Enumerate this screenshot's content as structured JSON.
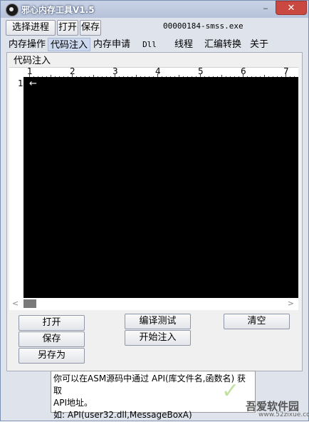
{
  "window": {
    "title": "邪心内存工具V1.5",
    "minimize": "‒",
    "close": "✕"
  },
  "toolbar": {
    "select_process": "选择进程",
    "open": "打开",
    "save": "保存",
    "process_label": "00000184-smss.exe"
  },
  "tabs": [
    "内存操作",
    "代码注入",
    "内存申请",
    "Dll",
    "线程",
    "汇编转换",
    "关于"
  ],
  "active_tab": "代码注入",
  "group": {
    "label": "代码注入"
  },
  "ruler": {
    "numbers": [
      "1",
      "2",
      "3",
      "4",
      "5",
      "6",
      "7"
    ]
  },
  "editor": {
    "line_number": "1",
    "cursor_glyph": "←",
    "background": "#000000"
  },
  "scrollbar": {
    "left": "<",
    "right": ">"
  },
  "buttons": {
    "open": "打开",
    "save": "保存",
    "save_as": "另存为",
    "compile_test": "编译测试",
    "start_inject": "开始注入",
    "clear": "清空"
  },
  "hint": {
    "line1": "你可以在ASM源码中通过 API(库文件名,函数名) 获取",
    "line2": "API地址。",
    "line3": "如: API(user32.dll,MessageBoxA)"
  },
  "watermark": {
    "text": "吾爱软件园",
    "url": "www.52zixue.com"
  }
}
